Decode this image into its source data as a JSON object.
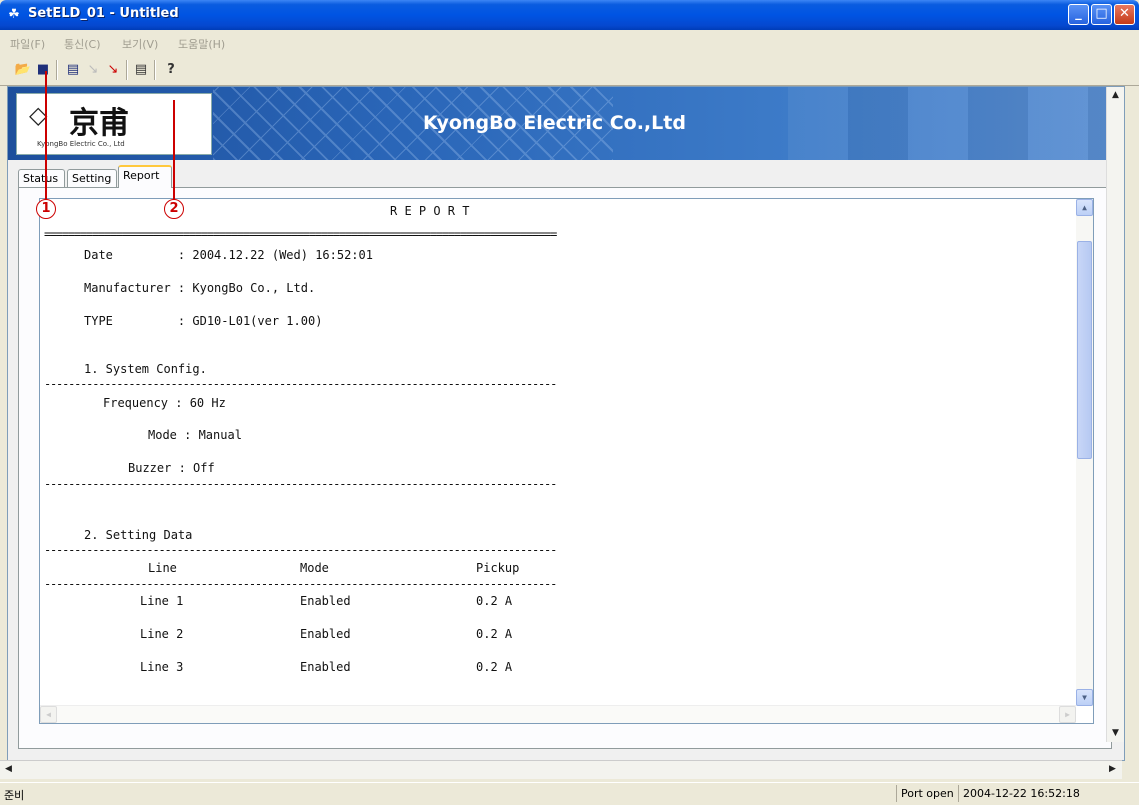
{
  "window": {
    "title": "SetELD_01 - Untitled",
    "app_icon": "☘"
  },
  "menu": [
    "파일(F)",
    "통신(C)",
    "보기(V)",
    "도움말(H)"
  ],
  "toolbar": {
    "icons": [
      "open-folder-icon",
      "save-disk-icon",
      "connect-icon",
      "disconnect-icon",
      "send-icon",
      "report-icon",
      "help-icon"
    ]
  },
  "banner": {
    "logo_cjk": "京甫",
    "logo_sub": "KyongBo Electric Co., Ltd",
    "company": "KyongBo Electric Co.,Ltd"
  },
  "tabs": [
    "Status",
    "Setting",
    "Report"
  ],
  "active_tab": "Report",
  "callouts": [
    "1",
    "2"
  ],
  "report": {
    "title": "R E P O R T",
    "double_rule": "=====================================================================================",
    "single_rule": "-------------------------------------------------------------------------------------",
    "date_line": "Date         : 2004.12.22 (Wed) 16:52:01",
    "manufacturer_line": "Manufacturer : KyongBo Co., Ltd.",
    "type_line": "TYPE         : GD10-L01(ver 1.00)",
    "section1": "1. System Config.",
    "frequency_line": "Frequency : 60 Hz",
    "mode_line": "Mode : Manual",
    "buzzer_line": "Buzzer : Off",
    "section2": "2. Setting Data",
    "table_headers": [
      "Line",
      "Mode",
      "Pickup"
    ],
    "rows": [
      [
        "Line 1",
        "Enabled",
        "0.2 A"
      ],
      [
        "Line 2",
        "Enabled",
        "0.2 A"
      ],
      [
        "Line 3",
        "Enabled",
        "0.2 A"
      ]
    ]
  },
  "status": {
    "left": "준비",
    "port": "Port open",
    "datetime": "2004-12-22 16:52:18"
  }
}
